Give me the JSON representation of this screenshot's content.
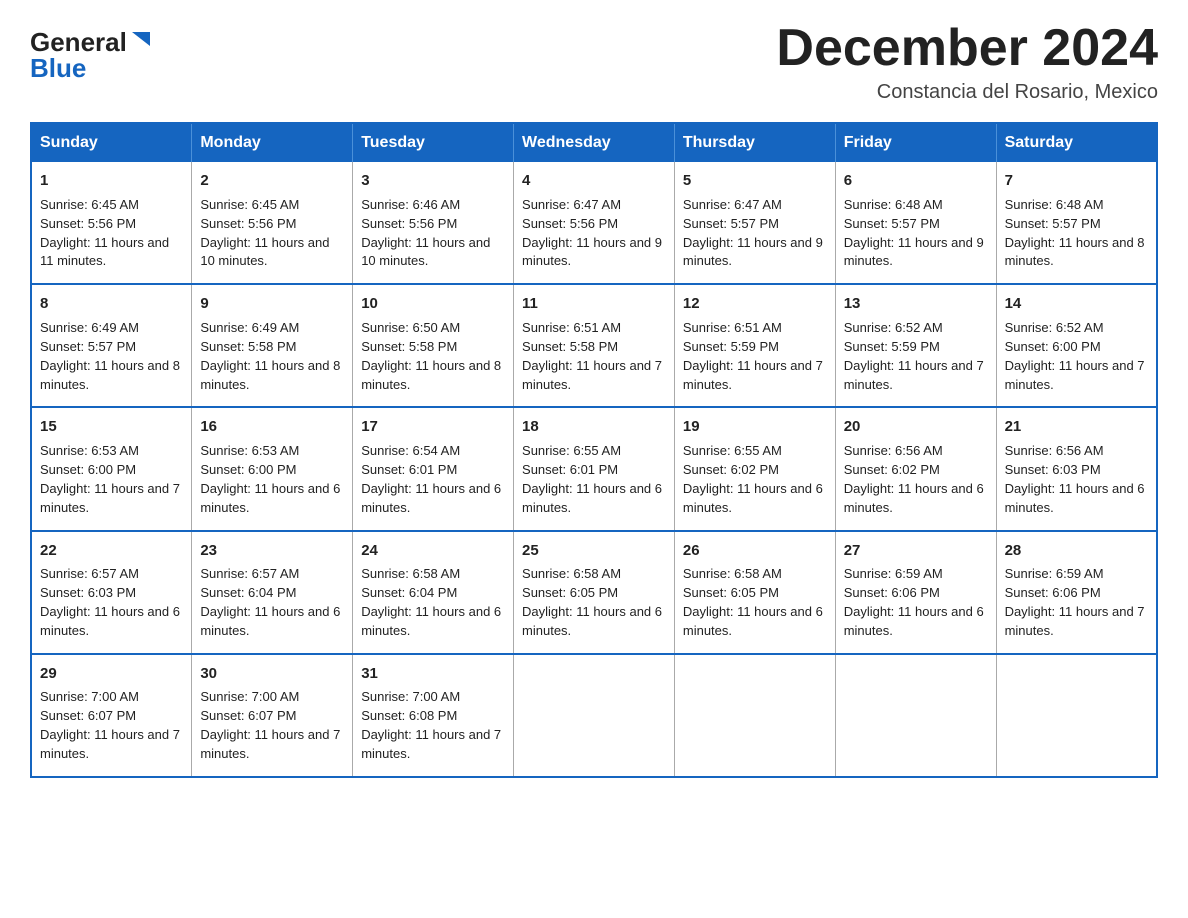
{
  "logo": {
    "general": "General",
    "blue": "Blue"
  },
  "title": "December 2024",
  "location": "Constancia del Rosario, Mexico",
  "days_header": [
    "Sunday",
    "Monday",
    "Tuesday",
    "Wednesday",
    "Thursday",
    "Friday",
    "Saturday"
  ],
  "weeks": [
    [
      {
        "day": "1",
        "sunrise": "6:45 AM",
        "sunset": "5:56 PM",
        "daylight": "11 hours and 11 minutes."
      },
      {
        "day": "2",
        "sunrise": "6:45 AM",
        "sunset": "5:56 PM",
        "daylight": "11 hours and 10 minutes."
      },
      {
        "day": "3",
        "sunrise": "6:46 AM",
        "sunset": "5:56 PM",
        "daylight": "11 hours and 10 minutes."
      },
      {
        "day": "4",
        "sunrise": "6:47 AM",
        "sunset": "5:56 PM",
        "daylight": "11 hours and 9 minutes."
      },
      {
        "day": "5",
        "sunrise": "6:47 AM",
        "sunset": "5:57 PM",
        "daylight": "11 hours and 9 minutes."
      },
      {
        "day": "6",
        "sunrise": "6:48 AM",
        "sunset": "5:57 PM",
        "daylight": "11 hours and 9 minutes."
      },
      {
        "day": "7",
        "sunrise": "6:48 AM",
        "sunset": "5:57 PM",
        "daylight": "11 hours and 8 minutes."
      }
    ],
    [
      {
        "day": "8",
        "sunrise": "6:49 AM",
        "sunset": "5:57 PM",
        "daylight": "11 hours and 8 minutes."
      },
      {
        "day": "9",
        "sunrise": "6:49 AM",
        "sunset": "5:58 PM",
        "daylight": "11 hours and 8 minutes."
      },
      {
        "day": "10",
        "sunrise": "6:50 AM",
        "sunset": "5:58 PM",
        "daylight": "11 hours and 8 minutes."
      },
      {
        "day": "11",
        "sunrise": "6:51 AM",
        "sunset": "5:58 PM",
        "daylight": "11 hours and 7 minutes."
      },
      {
        "day": "12",
        "sunrise": "6:51 AM",
        "sunset": "5:59 PM",
        "daylight": "11 hours and 7 minutes."
      },
      {
        "day": "13",
        "sunrise": "6:52 AM",
        "sunset": "5:59 PM",
        "daylight": "11 hours and 7 minutes."
      },
      {
        "day": "14",
        "sunrise": "6:52 AM",
        "sunset": "6:00 PM",
        "daylight": "11 hours and 7 minutes."
      }
    ],
    [
      {
        "day": "15",
        "sunrise": "6:53 AM",
        "sunset": "6:00 PM",
        "daylight": "11 hours and 7 minutes."
      },
      {
        "day": "16",
        "sunrise": "6:53 AM",
        "sunset": "6:00 PM",
        "daylight": "11 hours and 6 minutes."
      },
      {
        "day": "17",
        "sunrise": "6:54 AM",
        "sunset": "6:01 PM",
        "daylight": "11 hours and 6 minutes."
      },
      {
        "day": "18",
        "sunrise": "6:55 AM",
        "sunset": "6:01 PM",
        "daylight": "11 hours and 6 minutes."
      },
      {
        "day": "19",
        "sunrise": "6:55 AM",
        "sunset": "6:02 PM",
        "daylight": "11 hours and 6 minutes."
      },
      {
        "day": "20",
        "sunrise": "6:56 AM",
        "sunset": "6:02 PM",
        "daylight": "11 hours and 6 minutes."
      },
      {
        "day": "21",
        "sunrise": "6:56 AM",
        "sunset": "6:03 PM",
        "daylight": "11 hours and 6 minutes."
      }
    ],
    [
      {
        "day": "22",
        "sunrise": "6:57 AM",
        "sunset": "6:03 PM",
        "daylight": "11 hours and 6 minutes."
      },
      {
        "day": "23",
        "sunrise": "6:57 AM",
        "sunset": "6:04 PM",
        "daylight": "11 hours and 6 minutes."
      },
      {
        "day": "24",
        "sunrise": "6:58 AM",
        "sunset": "6:04 PM",
        "daylight": "11 hours and 6 minutes."
      },
      {
        "day": "25",
        "sunrise": "6:58 AM",
        "sunset": "6:05 PM",
        "daylight": "11 hours and 6 minutes."
      },
      {
        "day": "26",
        "sunrise": "6:58 AM",
        "sunset": "6:05 PM",
        "daylight": "11 hours and 6 minutes."
      },
      {
        "day": "27",
        "sunrise": "6:59 AM",
        "sunset": "6:06 PM",
        "daylight": "11 hours and 6 minutes."
      },
      {
        "day": "28",
        "sunrise": "6:59 AM",
        "sunset": "6:06 PM",
        "daylight": "11 hours and 7 minutes."
      }
    ],
    [
      {
        "day": "29",
        "sunrise": "7:00 AM",
        "sunset": "6:07 PM",
        "daylight": "11 hours and 7 minutes."
      },
      {
        "day": "30",
        "sunrise": "7:00 AM",
        "sunset": "6:07 PM",
        "daylight": "11 hours and 7 minutes."
      },
      {
        "day": "31",
        "sunrise": "7:00 AM",
        "sunset": "6:08 PM",
        "daylight": "11 hours and 7 minutes."
      },
      null,
      null,
      null,
      null
    ]
  ]
}
